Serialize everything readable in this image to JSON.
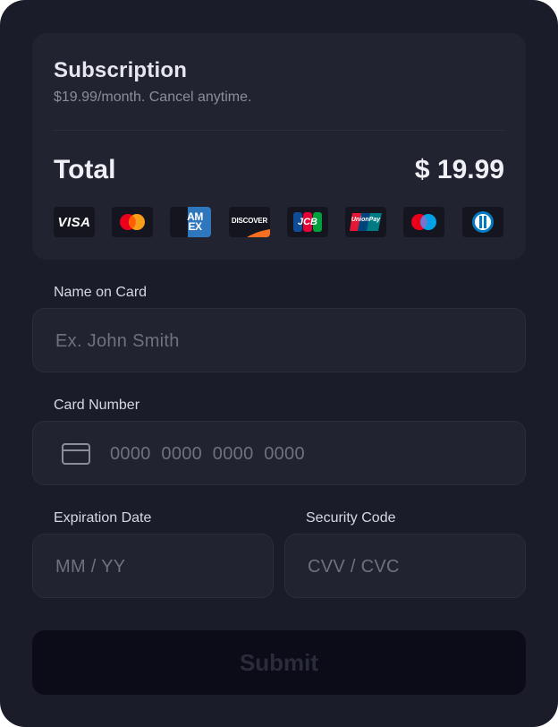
{
  "subscription": {
    "title": "Subscription",
    "description": "$19.99/month. Cancel anytime.",
    "total_label": "Total",
    "total_price": "$ 19.99"
  },
  "brands": [
    {
      "name": "visa-logo",
      "text": "VISA"
    },
    {
      "name": "mastercard-logo",
      "text": ""
    },
    {
      "name": "amex-logo",
      "text": "AM EX"
    },
    {
      "name": "discover-logo",
      "text": "DISCOVER"
    },
    {
      "name": "jcb-logo",
      "text": "JCB"
    },
    {
      "name": "unionpay-logo",
      "text": "UnionPay"
    },
    {
      "name": "maestro-logo",
      "text": ""
    },
    {
      "name": "diners-club-logo",
      "text": ""
    }
  ],
  "form": {
    "name_label": "Name on Card",
    "name_placeholder": "Ex. John Smith",
    "card_label": "Card Number",
    "card_placeholder": "0000  0000  0000  0000",
    "card_icon": "credit-card-icon",
    "expiry_label": "Expiration Date",
    "expiry_placeholder": "MM / YY",
    "cvv_label": "Security Code",
    "cvv_placeholder": "CVV / CVC",
    "submit_label": "Submit"
  },
  "colors": {
    "background": "#1b1c2a",
    "panel": "#222331",
    "submit_bg": "#0b0c17",
    "submit_text": "#2b2c3b",
    "mastercard_red": "#eb001b",
    "mastercard_orange": "#f79e1b",
    "amex_blue": "#2e77bc",
    "discover_orange": "#f76f20",
    "maestro_blue": "#00a2e5",
    "diners_blue": "#0079be"
  }
}
